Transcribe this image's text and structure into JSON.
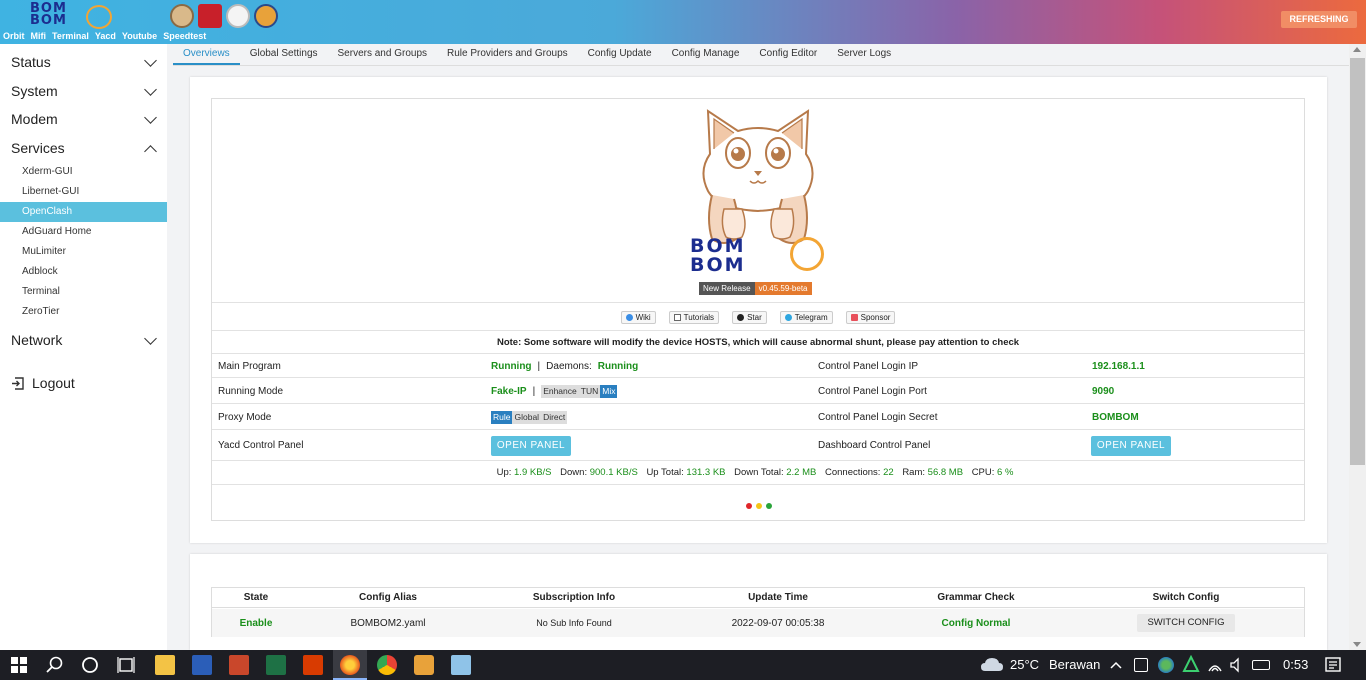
{
  "header": {
    "logo_text_1": "BOM",
    "logo_text_2": "BOM",
    "links": [
      "Orbit",
      "Mifi",
      "Terminal",
      "Yacd",
      "Youtube",
      "Speedtest"
    ],
    "status_button": "REFRESHING",
    "colors": {
      "gradient_start": "#3fb3e2",
      "gradient_end": "#ec6a3e",
      "status_button": "#f18d65"
    }
  },
  "sidebar": {
    "menus": [
      {
        "label": "Status",
        "expanded": false
      },
      {
        "label": "System",
        "expanded": false
      },
      {
        "label": "Modem",
        "expanded": false
      },
      {
        "label": "Services",
        "expanded": true
      }
    ],
    "services_items": [
      "Xderm-GUI",
      "Libernet-GUI",
      "OpenClash",
      "AdGuard Home",
      "MuLimiter",
      "Adblock",
      "Terminal",
      "ZeroTier"
    ],
    "active_item": "OpenClash",
    "network_label": "Network",
    "logout_label": "Logout",
    "colors": {
      "active_bg": "#5bc0de"
    }
  },
  "tabs": {
    "items": [
      "Overviews",
      "Global Settings",
      "Servers and Groups",
      "Rule Providers and Groups",
      "Config Update",
      "Config Manage",
      "Config Editor",
      "Server Logs"
    ],
    "active": "Overviews"
  },
  "overview": {
    "logo_text_1": "BOM",
    "logo_text_2": "BOM",
    "release_label": "New Release",
    "release_version": "v0.45.59-beta",
    "link_buttons": [
      "Wiki",
      "Tutorials",
      "Star",
      "Telegram",
      "Sponsor"
    ],
    "note": "Note: Some software will modify the device HOSTS, which will cause abnormal shunt, please pay attention to check",
    "main_program_label": "Main Program",
    "main_program_status": "Running",
    "separator": "|",
    "daemons_label": "Daemons:",
    "daemons_status": "Running",
    "running_mode_label": "Running Mode",
    "running_mode_value": "Fake-IP",
    "running_mode_options": [
      "Enhance",
      "TUN",
      "Mix"
    ],
    "running_mode_selected": "Mix",
    "proxy_mode_label": "Proxy Mode",
    "proxy_mode_options": [
      "Rule",
      "Global",
      "Direct"
    ],
    "proxy_mode_selected": "Rule",
    "yacd_label": "Yacd Control Panel",
    "open_panel": "OPEN PANEL",
    "cp_ip_label": "Control Panel Login IP",
    "cp_ip_value": "192.168.1.1",
    "cp_port_label": "Control Panel Login Port",
    "cp_port_value": "9090",
    "cp_secret_label": "Control Panel Login Secret",
    "cp_secret_value": "BOMBOM",
    "dashboard_label": "Dashboard Control Panel",
    "stats": {
      "up_label": "Up:",
      "up": "1.9 KB/S",
      "down_label": "Down:",
      "down": "900.1 KB/S",
      "up_total_label": "Up Total:",
      "up_total": "131.3 KB",
      "down_total_label": "Down Total:",
      "down_total": "2.2 MB",
      "connections_label": "Connections:",
      "connections": "22",
      "ram_label": "Ram:",
      "ram": "56.8 MB",
      "cpu_label": "CPU:",
      "cpu": "6 %"
    },
    "dot_colors": [
      "#e0262a",
      "#f5c518",
      "#2aa43a"
    ]
  },
  "config_table": {
    "headers": [
      "State",
      "Config Alias",
      "Subscription Info",
      "Update Time",
      "Grammar Check",
      "Switch Config"
    ],
    "row": {
      "state": "Enable",
      "alias": "BOMBOM2.yaml",
      "subscription": "No Sub Info Found",
      "update_time": "2022-09-07 00:05:38",
      "grammar": "Config Normal",
      "switch": "SWITCH CONFIG"
    }
  },
  "taskbar": {
    "weather_temp": "25°C",
    "weather_text": "Berawan",
    "time": "0:53",
    "icons": [
      "windows-icon",
      "search-icon",
      "cortana-icon",
      "task-view-icon",
      "file-explorer-icon",
      "word-icon",
      "powerpoint-icon",
      "excel-icon",
      "office-icon",
      "firefox-icon",
      "chrome-icon",
      "app-icon",
      "notepad-icon"
    ]
  }
}
